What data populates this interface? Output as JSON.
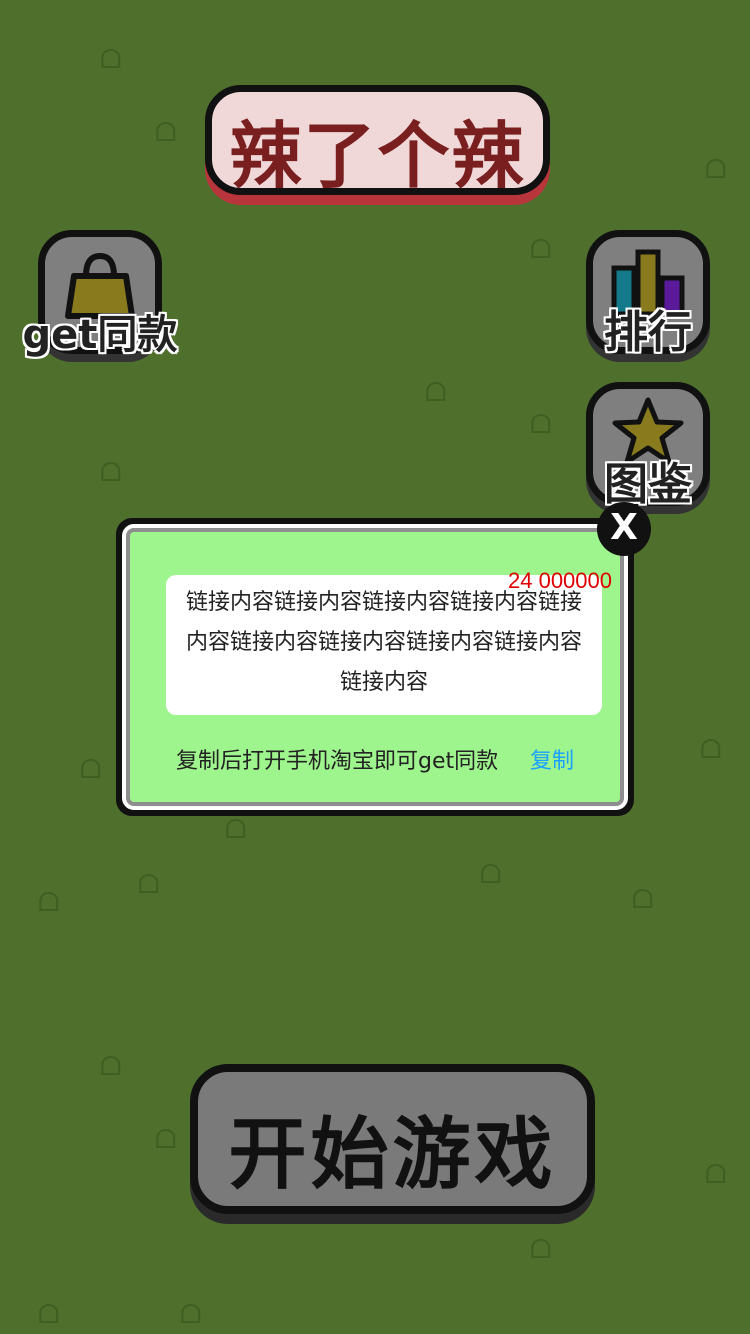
{
  "game": {
    "title": "辣了个辣",
    "start_button": "开始游戏"
  },
  "side_buttons": {
    "get_same": "get同款",
    "ranking": "排行",
    "collection": "图鉴"
  },
  "dialog": {
    "count": "24 000000",
    "link_content": "链接内容链接内容链接内容链接内容链接内容链接内容链接内容链接内容链接内容链接内容",
    "hint": "复制后打开手机淘宝即可get同款",
    "copy_label": "复制",
    "close_label": "X"
  },
  "icons": {
    "bag": "bag-icon",
    "chart": "chart-icon",
    "star": "star-icon",
    "close": "close-icon"
  },
  "colors": {
    "background": "#4f702d",
    "dialog_bg": "#9ff58d",
    "count_red": "#e00000",
    "copy_blue": "#1aa0ff",
    "title_red": "#7a1f1f"
  }
}
